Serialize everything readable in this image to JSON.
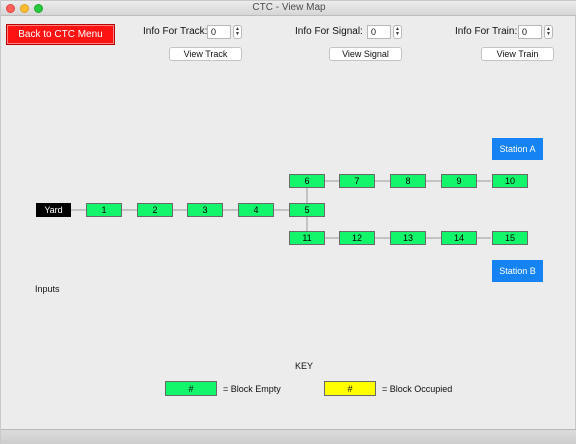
{
  "window": {
    "title": "CTC - View Map"
  },
  "toolbar": {
    "back_label": "Back to CTC Menu",
    "track_label": "Info For Track:",
    "track_value": "0",
    "view_track_label": "View Track",
    "signal_label": "Info For Signal:",
    "signal_value": "0",
    "view_signal_label": "View Signal",
    "train_label": "Info For Train:",
    "train_value": "0",
    "view_train_label": "View Train"
  },
  "map": {
    "yard_label": "Yard",
    "blocks": [
      "1",
      "2",
      "3",
      "4",
      "5",
      "6",
      "7",
      "8",
      "9",
      "10",
      "11",
      "12",
      "13",
      "14",
      "15"
    ],
    "stations": [
      "Station A",
      "Station B"
    ]
  },
  "inputs_label": "Inputs",
  "key": {
    "title": "KEY",
    "empty_symbol": "#",
    "empty_label": "= Block Empty",
    "occupied_symbol": "#",
    "occupied_label": "= Block Occupied"
  },
  "colors": {
    "block_empty": "#13f56b",
    "block_occupied": "#ffff00",
    "station": "#1583f3",
    "back_button": "#ff1212"
  }
}
